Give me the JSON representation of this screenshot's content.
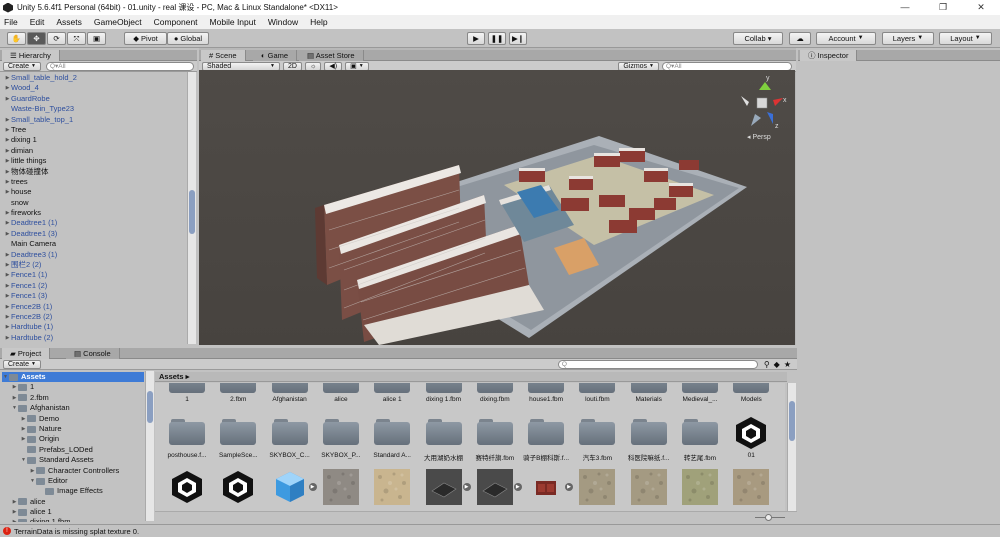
{
  "window": {
    "title": "Unity 5.6.4f1 Personal (64bit) - 01.unity - real 课设 - PC, Mac & Linux Standalone* <DX11>"
  },
  "menu": [
    "File",
    "Edit",
    "Assets",
    "GameObject",
    "Component",
    "Mobile Input",
    "Window",
    "Help"
  ],
  "toolbar": {
    "pivot": "Pivot",
    "global": "Global",
    "collab": "Collab ▾",
    "account": "Account",
    "layers": "Layers",
    "layout": "Layout"
  },
  "hierarchy": {
    "tab": "Hierarchy",
    "create": "Create",
    "search_placeholder": "Q▾All",
    "items": [
      {
        "label": "Small_table_hold_2",
        "prefab": true,
        "arrow": true
      },
      {
        "label": "Wood_4",
        "prefab": true,
        "arrow": true
      },
      {
        "label": "GuardRobe",
        "prefab": true,
        "arrow": true
      },
      {
        "label": "Waste-Bin_Type23",
        "prefab": true,
        "arrow": false
      },
      {
        "label": "Small_table_top_1",
        "prefab": true,
        "arrow": true
      },
      {
        "label": "Tree",
        "prefab": false,
        "arrow": true
      },
      {
        "label": "dixing 1",
        "prefab": false,
        "arrow": true
      },
      {
        "label": "dimian",
        "prefab": false,
        "arrow": true
      },
      {
        "label": "little things",
        "prefab": false,
        "arrow": true
      },
      {
        "label": "物体碰撞体",
        "prefab": false,
        "arrow": true
      },
      {
        "label": "trees",
        "prefab": false,
        "arrow": true
      },
      {
        "label": "house",
        "prefab": false,
        "arrow": true
      },
      {
        "label": "snow",
        "prefab": false,
        "arrow": false
      },
      {
        "label": "fireworks",
        "prefab": false,
        "arrow": true
      },
      {
        "label": "Deadtree1 (1)",
        "prefab": true,
        "arrow": true
      },
      {
        "label": "Deadtree1 (3)",
        "prefab": true,
        "arrow": true
      },
      {
        "label": "Main Camera",
        "prefab": false,
        "arrow": false
      },
      {
        "label": "Deadtree3 (1)",
        "prefab": true,
        "arrow": true
      },
      {
        "label": "围栏2 (2)",
        "prefab": true,
        "arrow": true
      },
      {
        "label": "Fence1 (1)",
        "prefab": true,
        "arrow": true
      },
      {
        "label": "Fence1 (2)",
        "prefab": true,
        "arrow": true
      },
      {
        "label": "Fence1 (3)",
        "prefab": true,
        "arrow": true
      },
      {
        "label": "Fence2B (1)",
        "prefab": true,
        "arrow": true
      },
      {
        "label": "Fence2B (2)",
        "prefab": true,
        "arrow": true
      },
      {
        "label": "Hardtube (1)",
        "prefab": true,
        "arrow": true
      },
      {
        "label": "Hardtube (2)",
        "prefab": true,
        "arrow": true
      }
    ]
  },
  "scene": {
    "tabs": [
      "Scene",
      "Game",
      "Asset Store"
    ],
    "shaded": "Shaded",
    "two_d": "2D",
    "gizmos": "Gizmos",
    "search_placeholder": "Q▾All",
    "persp": "◂ Persp",
    "axis_y": "y",
    "axis_x": "x",
    "axis_z": "z"
  },
  "inspector": {
    "tab": "Inspector"
  },
  "project": {
    "tabs": [
      "Project",
      "Console"
    ],
    "create": "Create",
    "tree": [
      {
        "label": "Assets",
        "depth": 0,
        "arrow": "open",
        "selected": true
      },
      {
        "label": "1",
        "depth": 1,
        "arrow": "closed"
      },
      {
        "label": "2.fbm",
        "depth": 1,
        "arrow": "closed"
      },
      {
        "label": "Afghanistan",
        "depth": 1,
        "arrow": "open"
      },
      {
        "label": "Demo",
        "depth": 2,
        "arrow": "closed"
      },
      {
        "label": "Nature",
        "depth": 2,
        "arrow": "closed"
      },
      {
        "label": "Origin",
        "depth": 2,
        "arrow": "closed"
      },
      {
        "label": "Prefabs_LODed",
        "depth": 2,
        "arrow": "none"
      },
      {
        "label": "Standard Assets",
        "depth": 2,
        "arrow": "open"
      },
      {
        "label": "Character Controllers",
        "depth": 3,
        "arrow": "closed"
      },
      {
        "label": "Editor",
        "depth": 3,
        "arrow": "open"
      },
      {
        "label": "Image Effects",
        "depth": 4,
        "arrow": "none"
      },
      {
        "label": "alice",
        "depth": 1,
        "arrow": "closed"
      },
      {
        "label": "alice 1",
        "depth": 1,
        "arrow": "closed"
      },
      {
        "label": "dixing 1.fbm",
        "depth": 1,
        "arrow": "closed"
      }
    ],
    "breadcrumb": "Assets ▸",
    "row1": [
      "1",
      "2.fbm",
      "Afghanistan",
      "alice",
      "alice 1",
      "dixing 1.fbm",
      "dixing.fbm",
      "house1.fbm",
      "louti.fbm",
      "Materials",
      "Medieval_...",
      "Models"
    ],
    "row2": [
      "posthouse.f...",
      "SampleSce...",
      "SKYBOX_C...",
      "SKYBOX_P...",
      "Standard A...",
      "大用湖奶水棚",
      "赛特纤旗.fbm",
      "骑子B棚科斯.f...",
      "汽车3.fbm",
      "科医院嘛纸.f...",
      "转艺尾.fbm",
      "01"
    ]
  },
  "status": {
    "message": "TerrainData is missing splat texture 0."
  }
}
